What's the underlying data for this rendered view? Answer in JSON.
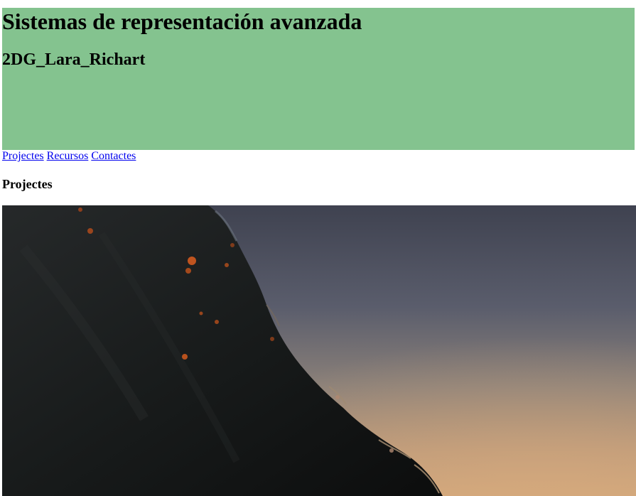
{
  "header": {
    "title": "Sistemas de representación avanzada",
    "subtitle": "2DG_Lara_Richart",
    "background_color": "#84c38f"
  },
  "nav": {
    "links": [
      {
        "label": "Projectes"
      },
      {
        "label": "Recursos"
      },
      {
        "label": "Contactes"
      }
    ],
    "link_color": "#0000ee"
  },
  "main": {
    "section_title": "Projectes",
    "hero_image": {
      "subject": "wave-at-sunset-photo"
    }
  }
}
